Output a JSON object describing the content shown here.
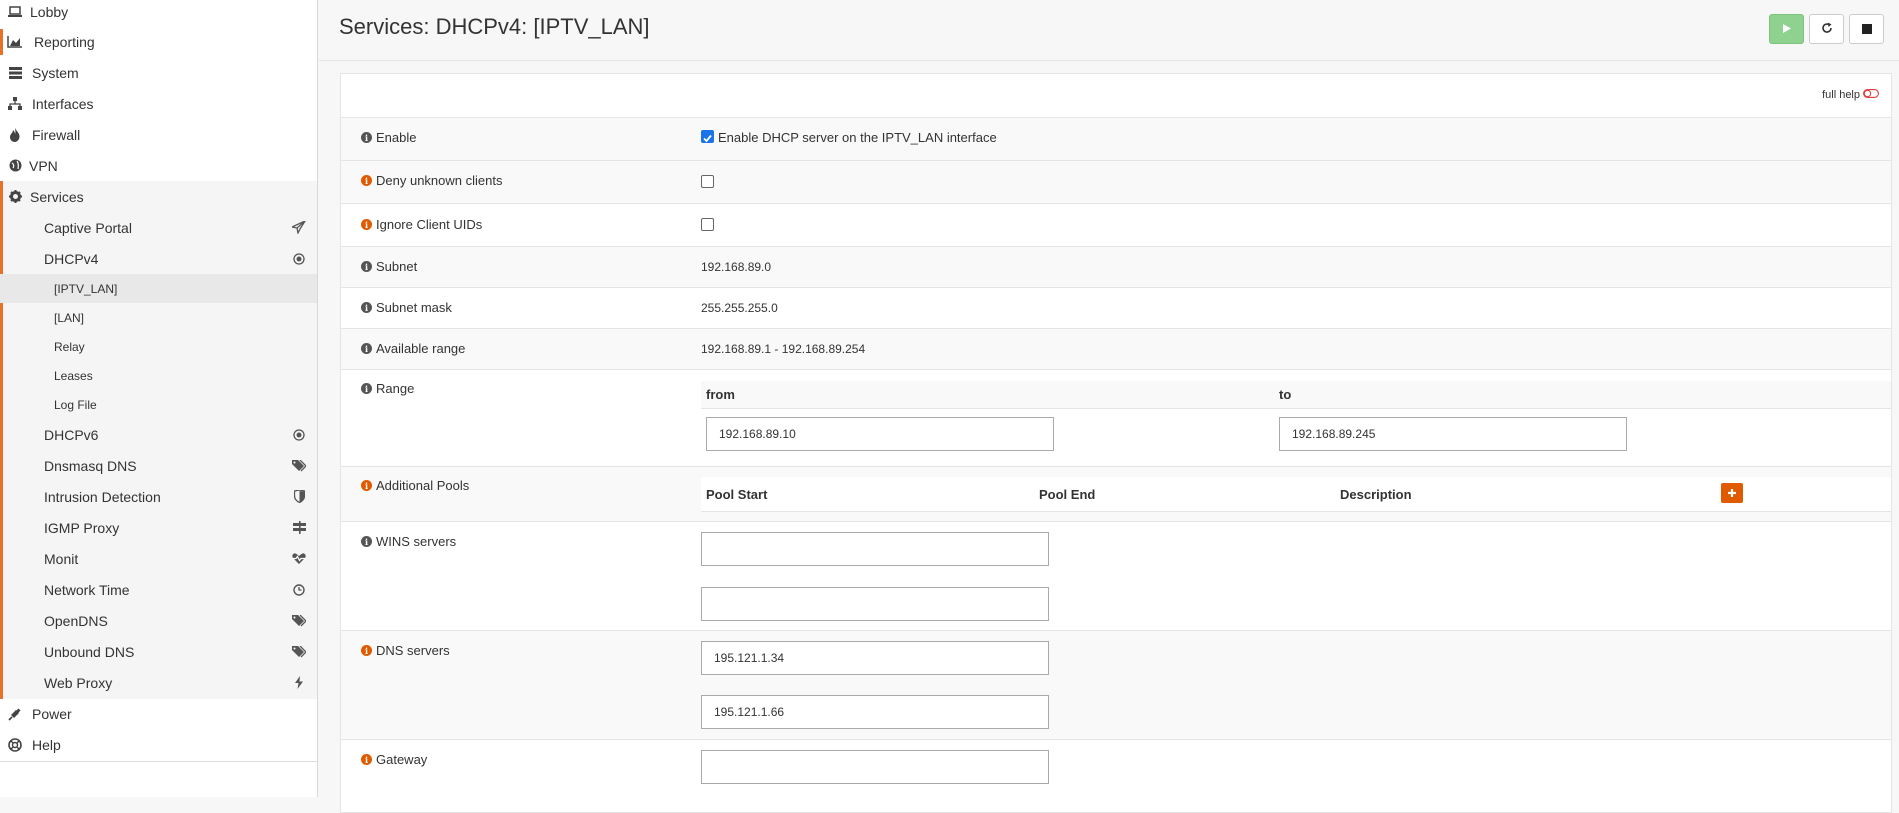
{
  "sidebar": {
    "top": [
      {
        "label": "Lobby",
        "icon": "laptop-icon"
      },
      {
        "label": "Reporting",
        "icon": "area-chart-icon"
      },
      {
        "label": "System",
        "icon": "server-icon"
      },
      {
        "label": "Interfaces",
        "icon": "sitemap-icon"
      },
      {
        "label": "Firewall",
        "icon": "fire-icon"
      },
      {
        "label": "VPN",
        "icon": "globe-icon"
      },
      {
        "label": "Services",
        "icon": "gear-icon"
      }
    ],
    "services_children": [
      {
        "label": "Captive Portal",
        "icon": "paper-plane-icon"
      },
      {
        "label": "DHCPv4",
        "icon": "bullseye-icon"
      }
    ],
    "dhcpv4_children": [
      "[IPTV_LAN]",
      "[LAN]",
      "Relay",
      "Leases",
      "Log File"
    ],
    "services_more": [
      {
        "label": "DHCPv6",
        "icon": "bullseye-icon"
      },
      {
        "label": "Dnsmasq DNS",
        "icon": "tags-icon"
      },
      {
        "label": "Intrusion Detection",
        "icon": "shield-icon"
      },
      {
        "label": "IGMP Proxy",
        "icon": "signpost-icon"
      },
      {
        "label": "Monit",
        "icon": "heartbeat-icon"
      },
      {
        "label": "Network Time",
        "icon": "clock-icon"
      },
      {
        "label": "OpenDNS",
        "icon": "tags-icon"
      },
      {
        "label": "Unbound DNS",
        "icon": "tags-icon"
      },
      {
        "label": "Web Proxy",
        "icon": "bolt-icon"
      }
    ],
    "bottom": [
      {
        "label": "Power",
        "icon": "plug-icon"
      },
      {
        "label": "Help",
        "icon": "lifebuoy-icon"
      }
    ]
  },
  "header": {
    "title": "Services: DHCPv4: [IPTV_LAN]",
    "buttons": [
      "play-icon",
      "refresh-icon",
      "stop-icon"
    ]
  },
  "form": {
    "full_help": "full help",
    "enable": {
      "label": "Enable",
      "text": "Enable DHCP server on the IPTV_LAN interface",
      "checked": true
    },
    "deny": {
      "label": "Deny unknown clients",
      "checked": false
    },
    "ignore": {
      "label": "Ignore Client UIDs",
      "checked": false
    },
    "subnet": {
      "label": "Subnet",
      "value": "192.168.89.0"
    },
    "subnet_mask": {
      "label": "Subnet mask",
      "value": "255.255.255.0"
    },
    "available_range": {
      "label": "Available range",
      "value": "192.168.89.1 - 192.168.89.254"
    },
    "range": {
      "label": "Range",
      "from_label": "from",
      "to_label": "to",
      "from": "192.168.89.10",
      "to": "192.168.89.245"
    },
    "pools": {
      "label": "Additional Pools",
      "cols": [
        "Pool Start",
        "Pool End",
        "Description"
      ]
    },
    "wins": {
      "label": "WINS servers",
      "values": [
        "",
        ""
      ]
    },
    "dns": {
      "label": "DNS servers",
      "values": [
        "195.121.1.34",
        "195.121.1.66"
      ]
    },
    "gateway": {
      "label": "Gateway",
      "value": ""
    }
  },
  "colors": {
    "accent": "#e6712a",
    "play": "#8fd18f",
    "add": "#e05a00"
  }
}
